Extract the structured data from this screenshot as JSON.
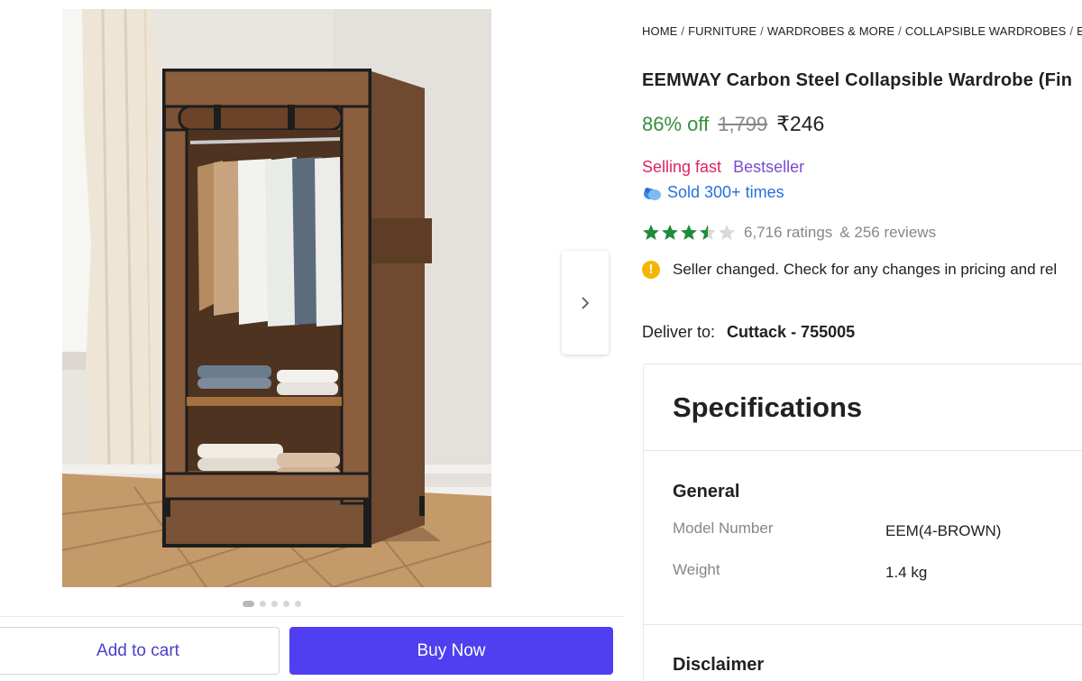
{
  "gallery": {
    "image_alt": "Brown collapsible wardrobe with hanging clothes and folded garments",
    "dot_count": 5,
    "active_dot": 0
  },
  "actions": {
    "add_to_cart": "Add to cart",
    "buy_now": "Buy Now"
  },
  "breadcrumb": [
    "HOME",
    "FURNITURE",
    "WARDROBES & MORE",
    "COLLAPSIBLE WARDROBES",
    "EE"
  ],
  "product": {
    "title": "EEMWAY Carbon Steel Collapsible Wardrobe (Fin",
    "discount": "86% off",
    "mrp": "1,799",
    "price": "₹246",
    "badge_fast": "Selling fast",
    "badge_best": "Bestseller",
    "sold": "Sold 300+ times",
    "rating_value": 3.5,
    "ratings": "6,716 ratings",
    "reviews": "& 256 reviews",
    "notice": "Seller changed. Check for any changes in pricing and rel"
  },
  "delivery": {
    "label": "Deliver to:",
    "location": "Cuttack - 755005"
  },
  "specifications": {
    "title": "Specifications",
    "section": "General",
    "rows": [
      {
        "key": "Model Number",
        "value": "EEM(4-BROWN)"
      },
      {
        "key": "Weight",
        "value": "1.4 kg"
      }
    ],
    "disclaimer": "Disclaimer"
  },
  "colors": {
    "discount": "#388e3c",
    "buy_now": "#4f3ff0",
    "selling_fast": "#e0245e",
    "bestseller": "#7a4bd3",
    "sold": "#2a6fdb",
    "star": "#1e8c3a",
    "info": "#f5b400"
  },
  "icons": {
    "next": "chevron-right-icon",
    "sold": "shopping-bag-icon",
    "notice": "info-icon"
  }
}
